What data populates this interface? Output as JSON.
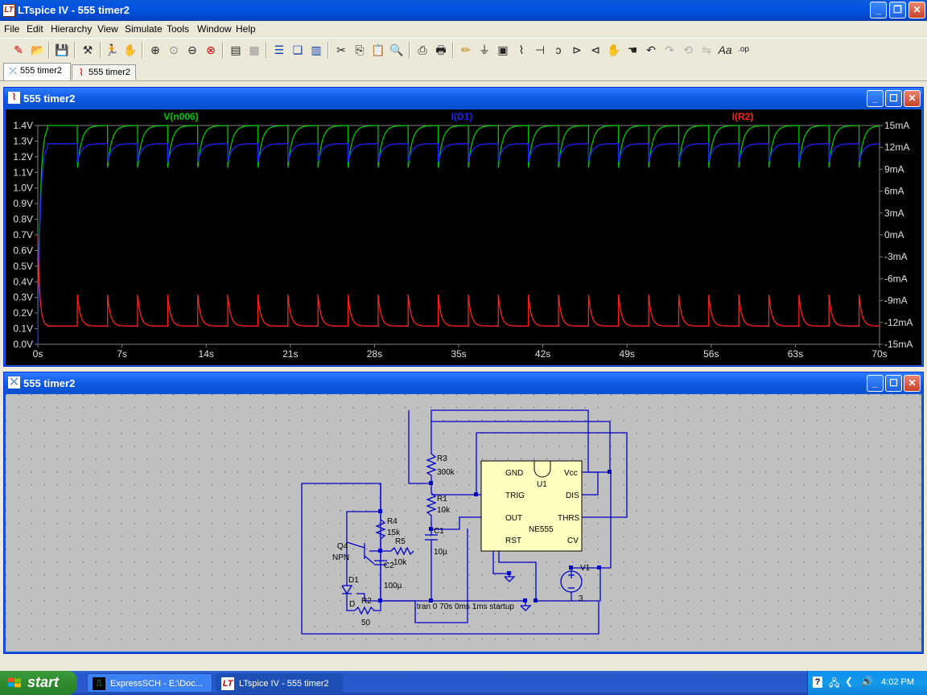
{
  "window": {
    "title": "LTspice IV - 555 timer2",
    "app_icon": "LT"
  },
  "menu": [
    "File",
    "Edit",
    "Hierarchy",
    "View",
    "Simulate",
    "Tools",
    "Window",
    "Help"
  ],
  "tabs": [
    {
      "label": "555 timer2",
      "icon": "schematic-icon"
    },
    {
      "label": "555 timer2",
      "icon": "waveform-icon"
    }
  ],
  "plot_window": {
    "title": "555 timer2"
  },
  "schematic_window": {
    "title": "555 timer2"
  },
  "chart_data": {
    "type": "line",
    "background": "#000000",
    "series": [
      {
        "name": "V(n006)",
        "color": "#00c800",
        "axis": "left",
        "high": 1.4,
        "low": 1.13,
        "initial": 0.0
      },
      {
        "name": "I(D1)",
        "color": "#2020ff",
        "axis": "right",
        "high": 12.5,
        "low": 10.0,
        "initial": -15.0
      },
      {
        "name": "I(R2)",
        "color": "#ff2020",
        "axis": "right",
        "high": -8.2,
        "low": -12.5,
        "initial": 0.0
      }
    ],
    "period_s": 2.5,
    "first_cycle_s": 3.3,
    "x": {
      "min": 0,
      "max": 70,
      "ticks": [
        "0s",
        "7s",
        "14s",
        "21s",
        "28s",
        "35s",
        "42s",
        "49s",
        "56s",
        "63s",
        "70s"
      ]
    },
    "y_left": {
      "min": 0.0,
      "max": 1.4,
      "ticks": [
        "1.4V",
        "1.3V",
        "1.2V",
        "1.1V",
        "1.0V",
        "0.9V",
        "0.8V",
        "0.7V",
        "0.6V",
        "0.5V",
        "0.4V",
        "0.3V",
        "0.2V",
        "0.1V",
        "0.0V"
      ]
    },
    "y_right": {
      "min": -15,
      "max": 15,
      "ticks": [
        "15mA",
        "12mA",
        "9mA",
        "6mA",
        "3mA",
        "0mA",
        "-3mA",
        "-6mA",
        "-9mA",
        "-12mA",
        "-15mA"
      ]
    }
  },
  "schematic": {
    "labels": {
      "r3": "R3",
      "r3v": "300k",
      "r1": "R1",
      "r1v": "10k",
      "c1": "C1",
      "c1v": "10µ",
      "r4": "R4",
      "r4v": "15k",
      "r5": "R5",
      "r5v": "10k",
      "q4": "Q4",
      "q4v": "NPN",
      "c2": "C2",
      "c2v": "100µ",
      "d1": "D1",
      "d1v": "D",
      "r2": "R2",
      "r2v": "50",
      "u1": "U1",
      "u1v": "NE555",
      "gnd": "GND",
      "vcc": "Vcc",
      "trig": "TRIG",
      "dis": "DIS",
      "out": "OUT",
      "thrs": "THRS",
      "rst": "RST",
      "cv": "CV",
      "v1": "V1",
      "v1v": "3",
      "directive": ".tran 0 70s 0ms 1ms startup"
    }
  },
  "taskbar": {
    "start": "start",
    "tasks": [
      {
        "label": "ExpressSCH - E:\\Doc...",
        "icon": "expresssch-icon"
      },
      {
        "label": "LTspice IV - 555 timer2",
        "icon": "ltspice-icon"
      }
    ],
    "clock": "4:02 PM"
  }
}
